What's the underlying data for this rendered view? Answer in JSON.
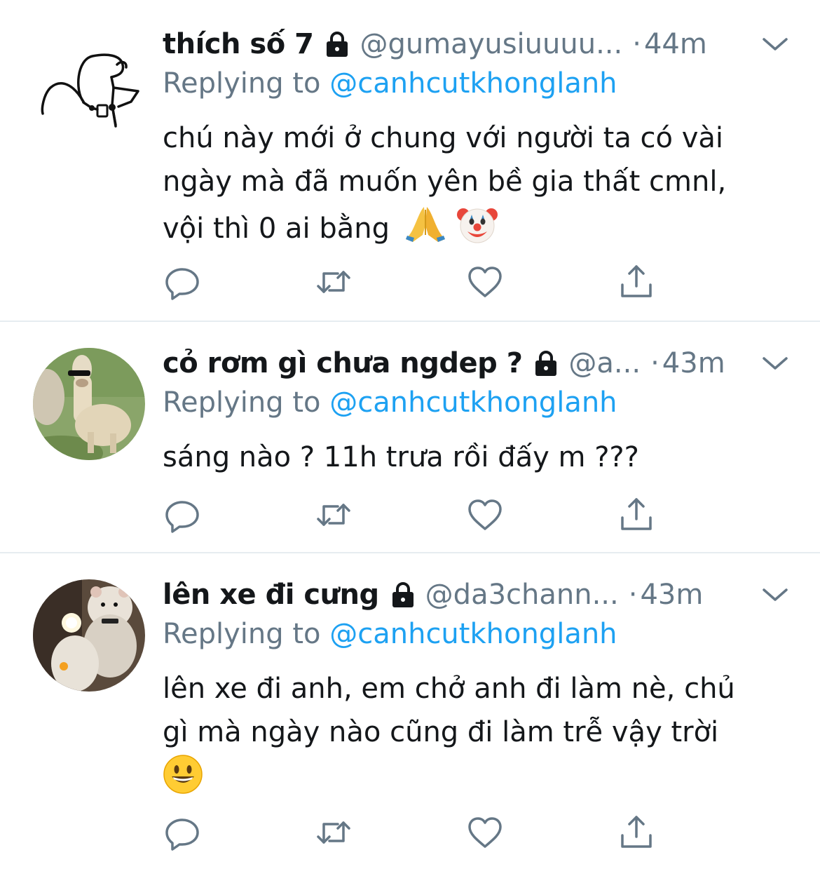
{
  "tweets": [
    {
      "name": "thích số 7",
      "handle": "@gumayusiuuuu...",
      "dot": "·",
      "time": "44m",
      "replying_prefix": "Replying to ",
      "replying_to": "@canhcutkhonglanh",
      "text_lines": [
        "chú này mới ở chung với người ta có vài",
        "ngày mà đã muốn yên bề gia thất cmnl,",
        "vội thì 0 ai bằng"
      ],
      "emojis": [
        "folded-hands",
        "clown-face"
      ],
      "avatar": "stick-figure-drawing"
    },
    {
      "name": "cỏ rơm gì chưa ngdep ?",
      "handle": "@a...",
      "dot": "·",
      "time": "43m",
      "replying_prefix": "Replying to ",
      "replying_to": "@canhcutkhonglanh",
      "text_lines": [
        "sáng nào ? 11h trưa rồi đấy m ???"
      ],
      "emojis": [],
      "avatar": "alpaca-with-sunglasses"
    },
    {
      "name": "lên xe đi cưng",
      "handle": "@da3chann...",
      "dot": "·",
      "time": "43m",
      "replying_prefix": "Replying to ",
      "replying_to": "@canhcutkhonglanh",
      "text_lines": [
        "lên xe đi anh, em chở anh đi làm nè, chủ",
        "gì mà ngày nào cũng đi làm trễ vậy trời"
      ],
      "emojis": [
        "grinning-face"
      ],
      "avatar": "hamster-on-scooter"
    }
  ],
  "icons": [
    "lock-icon",
    "chevron-down-icon",
    "reply-icon",
    "retweet-icon",
    "like-icon",
    "share-icon"
  ],
  "colors": {
    "text": "#14171a",
    "secondary": "#657786",
    "link": "#1da1f2",
    "divider": "#e6ecf0"
  }
}
